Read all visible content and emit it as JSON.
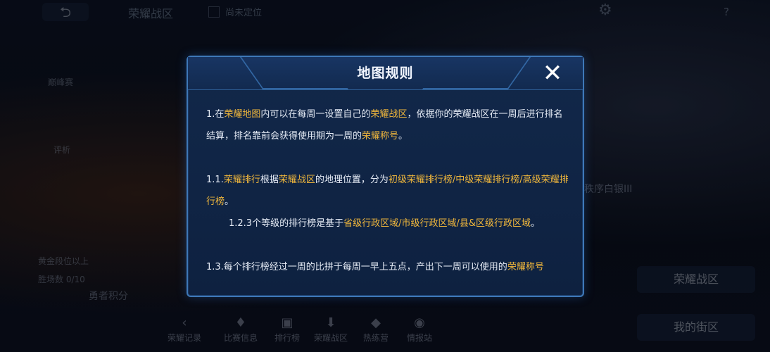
{
  "background": {
    "top_title": "荣耀战区",
    "location_text": "尚未定位",
    "left_panel": [
      "巅峰赛",
      "评析",
      "黄金段位以上",
      "胜场数 0/10"
    ],
    "right_rank": "秩序白银III",
    "region_button": "荣耀战区",
    "my_region_button": "我的街区",
    "score_label": "勇者积分",
    "bottom_nav": [
      "荣耀记录",
      "比赛信息",
      "排行榜",
      "荣耀战区",
      "热练营",
      "情报站"
    ]
  },
  "modal": {
    "title": "地图规则",
    "p1": {
      "a": "1.在",
      "b": "荣耀地图",
      "c": "内可以在每周一设置自己的",
      "d": "荣耀战区",
      "e": "，依据你的荣耀战区在一周后进行排名结算，排名靠前会获得使用期为一周的",
      "f": "荣耀称号",
      "g": "。"
    },
    "p2": {
      "a": "1.1.",
      "b": "荣耀排行",
      "c": "根据",
      "d": "荣耀战区",
      "e": "的地理位置，分为",
      "f": "初级荣耀排行榜/中级荣耀排行榜/高级荣耀排行榜",
      "g": "。"
    },
    "p3": {
      "a": "1.2.3个等级的排行榜是基于",
      "b": "省级行政区域/市级行政区域/县&区级行政区域",
      "c": "。"
    },
    "p4": {
      "a": "1.3.每个排行榜经过一周的比拼于每周一早上五点，产出下一周可以使用的",
      "b": "荣耀称号"
    }
  },
  "colors": {
    "highlight": "#f0b73c",
    "text": "#e6ecf6",
    "border": "#3e78b8"
  }
}
